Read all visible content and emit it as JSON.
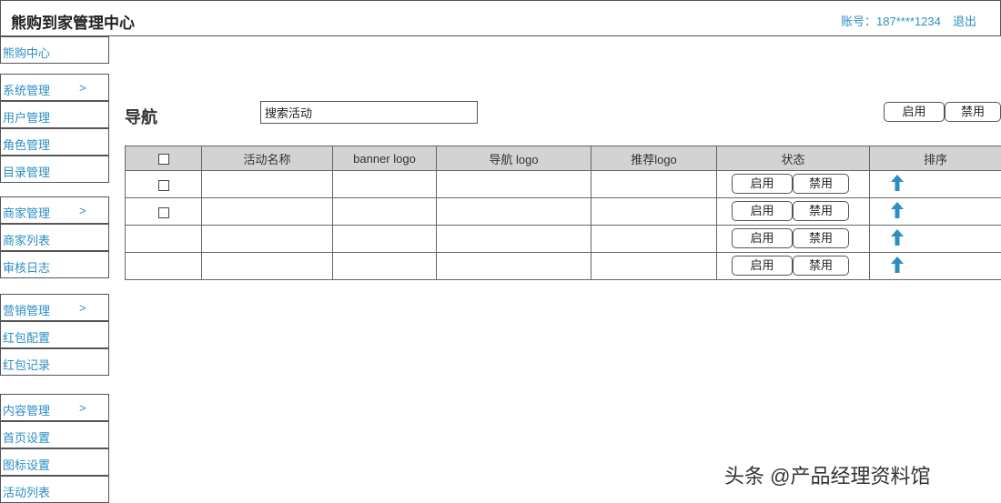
{
  "header": {
    "title": "熊购到家管理中心",
    "account_label": "账号：",
    "account_value": "187****1234",
    "logout": "退出"
  },
  "sidebar": {
    "home": "熊购中心",
    "groups": [
      {
        "label": "系统管理",
        "chevron": ">",
        "items": [
          "用户管理",
          "角色管理",
          "目录管理"
        ]
      },
      {
        "label": "商家管理",
        "chevron": ">",
        "items": [
          "商家列表",
          "审核日志"
        ]
      },
      {
        "label": "营销管理",
        "chevron": ">",
        "items": [
          "红包配置",
          "红包记录"
        ]
      },
      {
        "label": "内容管理",
        "chevron": ">",
        "items": [
          "首页设置",
          "图标设置",
          "活动列表"
        ]
      }
    ]
  },
  "main": {
    "title": "导航",
    "search": {
      "value": "搜索活动",
      "placeholder": "搜索活动"
    },
    "enable_label": "启用",
    "disable_label": "禁用",
    "table": {
      "headers": [
        "活动名称",
        "banner logo",
        "导航 logo",
        "推荐logo",
        "状态",
        "排序"
      ],
      "rows": [
        {
          "checkbox": true,
          "enable": "启用",
          "disable": "禁用"
        },
        {
          "checkbox": true,
          "enable": "启用",
          "disable": "禁用"
        },
        {
          "checkbox": false,
          "enable": "启用",
          "disable": "禁用"
        },
        {
          "checkbox": false,
          "enable": "启用",
          "disable": "禁用"
        }
      ]
    }
  },
  "icons": {
    "sort": "arrow-up-icon",
    "sort_color": "#2b8fc4"
  },
  "colors": {
    "accent": "#2b8fc4",
    "header_bg": "#d3d3d3"
  },
  "watermark": "头条 @产品经理资料馆"
}
